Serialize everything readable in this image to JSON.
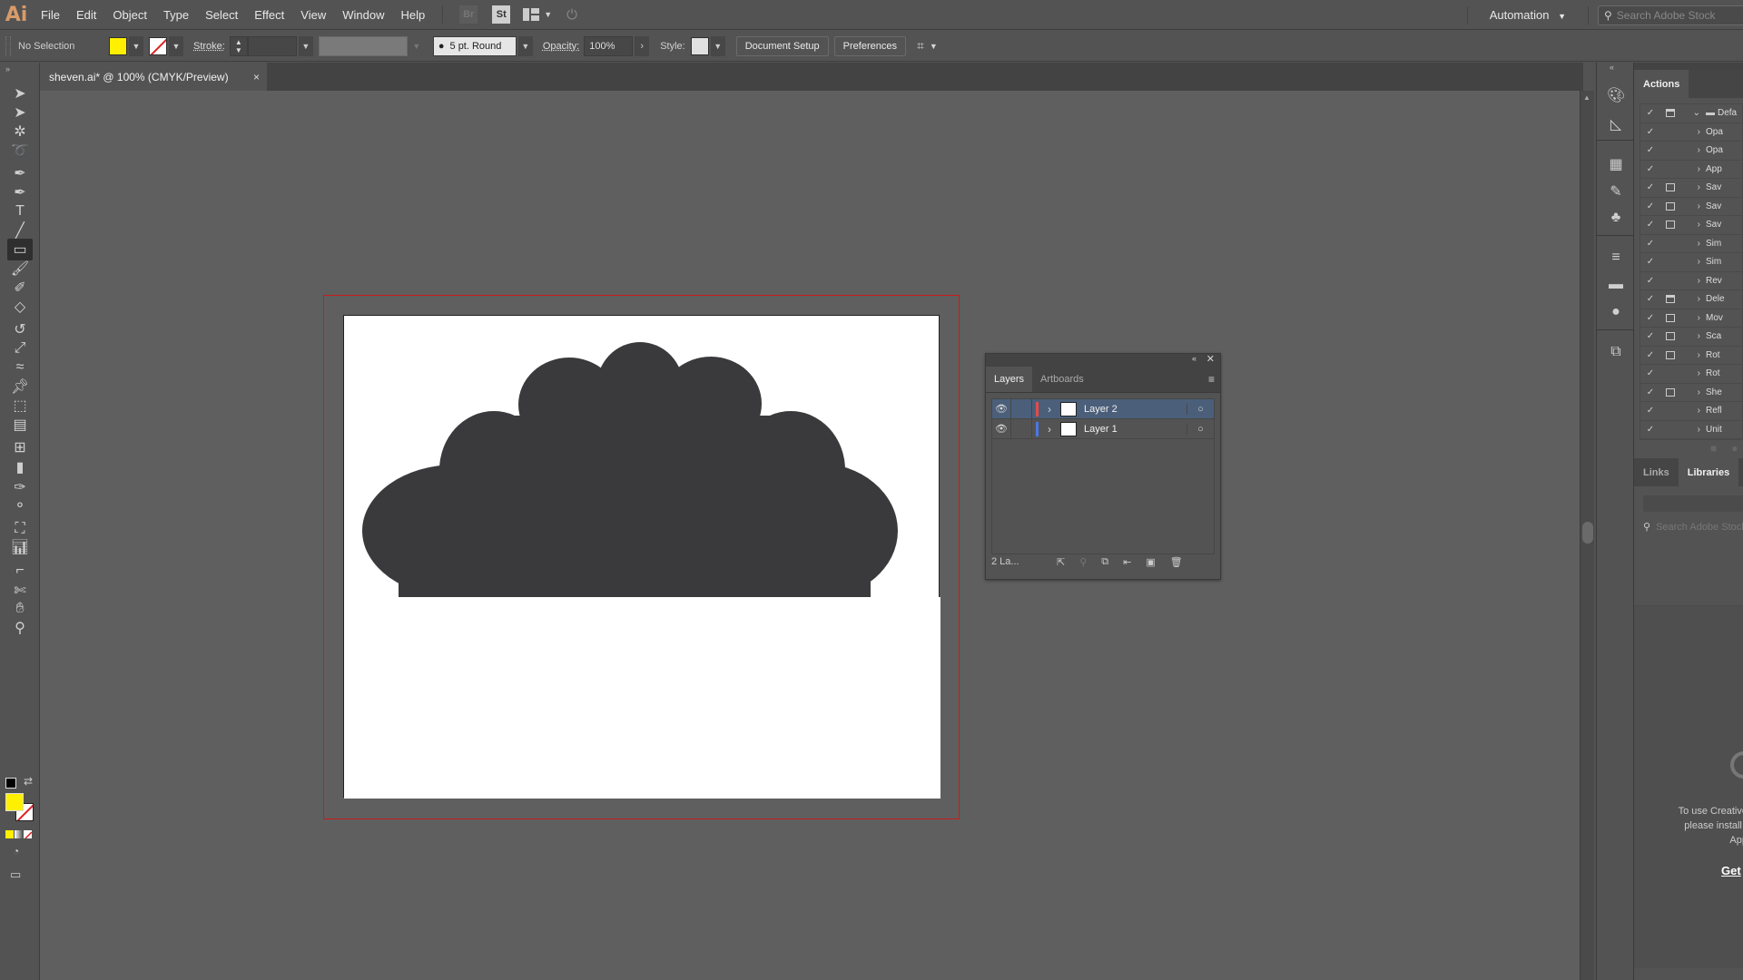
{
  "app": {
    "logo": "Ai"
  },
  "menu": [
    "File",
    "Edit",
    "Object",
    "Type",
    "Select",
    "Effect",
    "View",
    "Window",
    "Help"
  ],
  "app_icons": {
    "bridge": "Br",
    "stock": "St"
  },
  "workspace": "Automation",
  "stock_search": {
    "placeholder": "Search Adobe Stock"
  },
  "control": {
    "selection": "No Selection",
    "fill_color": "#ffef00",
    "stroke_label": "Stroke:",
    "stroke_weight": "",
    "brush": "5 pt. Round",
    "opacity_label": "Opacity:",
    "opacity": "100%",
    "style_label": "Style:",
    "document_setup": "Document Setup",
    "preferences": "Preferences"
  },
  "document_tab": {
    "title": "sheven.ai* @ 100% (CMYK/Preview)",
    "close": "×"
  },
  "tools": [
    "selection",
    "direct-selection",
    "magic-wand",
    "lasso",
    "pen",
    "curvature",
    "type",
    "line-segment",
    "rectangle",
    "paintbrush",
    "shaper",
    "eraser",
    "rotate",
    "scale",
    "width",
    "puppet-warp",
    "free-transform",
    "perspective-grid",
    "mesh",
    "gradient",
    "eyedropper",
    "blend",
    "symbol-sprayer",
    "column-graph",
    "artboard",
    "slice",
    "hand",
    "zoom"
  ],
  "artwork": {
    "shape": "cloud",
    "fill": "#3a3a3c"
  },
  "layers_panel": {
    "tabs": [
      "Layers",
      "Artboards"
    ],
    "layers": [
      {
        "name": "Layer 2",
        "color": "#e54a4a",
        "selected": true
      },
      {
        "name": "Layer 1",
        "color": "#4a78e5",
        "selected": false
      }
    ],
    "footer": "2 La..."
  },
  "actions_panel": {
    "tab": "Actions",
    "rows": [
      {
        "label": "Defa",
        "box": "dialog",
        "folder": true
      },
      {
        "label": "Opa",
        "box": ""
      },
      {
        "label": "Opa",
        "box": ""
      },
      {
        "label": "App",
        "box": ""
      },
      {
        "label": "Sav",
        "box": "empty"
      },
      {
        "label": "Sav",
        "box": "empty"
      },
      {
        "label": "Sav",
        "box": "empty"
      },
      {
        "label": "Sim",
        "box": ""
      },
      {
        "label": "Sim",
        "box": ""
      },
      {
        "label": "Rev",
        "box": ""
      },
      {
        "label": "Dele",
        "box": "dialog"
      },
      {
        "label": "Mov",
        "box": "empty"
      },
      {
        "label": "Sca",
        "box": "empty"
      },
      {
        "label": "Rot",
        "box": "empty"
      },
      {
        "label": "Rot",
        "box": ""
      },
      {
        "label": "She",
        "box": "empty"
      },
      {
        "label": "Refl",
        "box": ""
      },
      {
        "label": "Unit",
        "box": ""
      }
    ]
  },
  "libraries_panel": {
    "tabs": [
      "Links",
      "Libraries"
    ],
    "search_placeholder": "Search Adobe Stock",
    "message_line1": "To use Creative",
    "message_line2": "please install t",
    "message_line3": "App",
    "link": "Get"
  }
}
